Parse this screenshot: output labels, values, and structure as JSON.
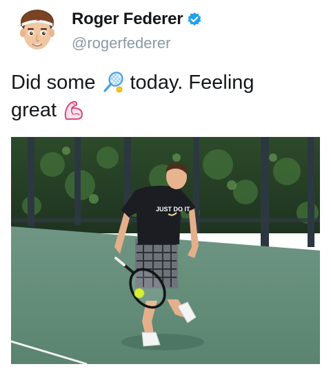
{
  "user": {
    "display_name": "Roger Federer",
    "handle": "@rogerfederer",
    "verified": true,
    "avatar_icon": "memoji-avatar-icon"
  },
  "tweet": {
    "text_line1_before": "Did some",
    "emoji1": "tennis-racket-emoji",
    "text_line1_after": "today. Feeling",
    "text_line2": "great",
    "emoji2": "flexed-biceps-emoji"
  },
  "media": {
    "shirt_text": "JUST DO IT."
  },
  "colors": {
    "verified_blue": "#1da1f2",
    "handle_gray": "#8899a6",
    "court_green": "#5f8a74"
  }
}
